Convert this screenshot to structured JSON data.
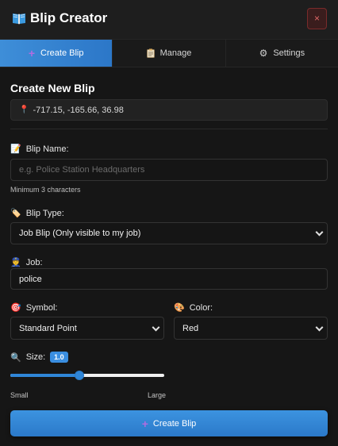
{
  "header": {
    "title": "Blip Creator",
    "logo_icon": "book-icon",
    "close_label": "×"
  },
  "tabs": [
    {
      "label": "Create Blip",
      "icon": "plus-icon",
      "active": true
    },
    {
      "label": "Manage",
      "icon": "clipboard-icon",
      "active": false
    },
    {
      "label": "Settings",
      "icon": "gear-icon",
      "active": false
    }
  ],
  "form": {
    "section_title": "Create New Blip",
    "coords": "-717.15, -165.66, 36.98",
    "name": {
      "label": "Blip Name:",
      "placeholder": "e.g. Police Station Headquarters",
      "value": "",
      "hint": "Minimum 3 characters"
    },
    "type": {
      "label": "Blip Type:",
      "selected": "Job Blip (Only visible to my job)"
    },
    "job": {
      "label": "Job:",
      "value": "police"
    },
    "symbol": {
      "label": "Symbol:",
      "selected": "Standard Point"
    },
    "color": {
      "label": "Color:",
      "selected": "Red"
    },
    "size": {
      "label": "Size:",
      "value": "1.0",
      "fraction": 0.45,
      "min_label": "Small",
      "max_label": "Large"
    },
    "submit_label": "Create Blip"
  },
  "colors": {
    "accent": "#3a8ee0",
    "background": "#161616",
    "close": "#e06767"
  }
}
